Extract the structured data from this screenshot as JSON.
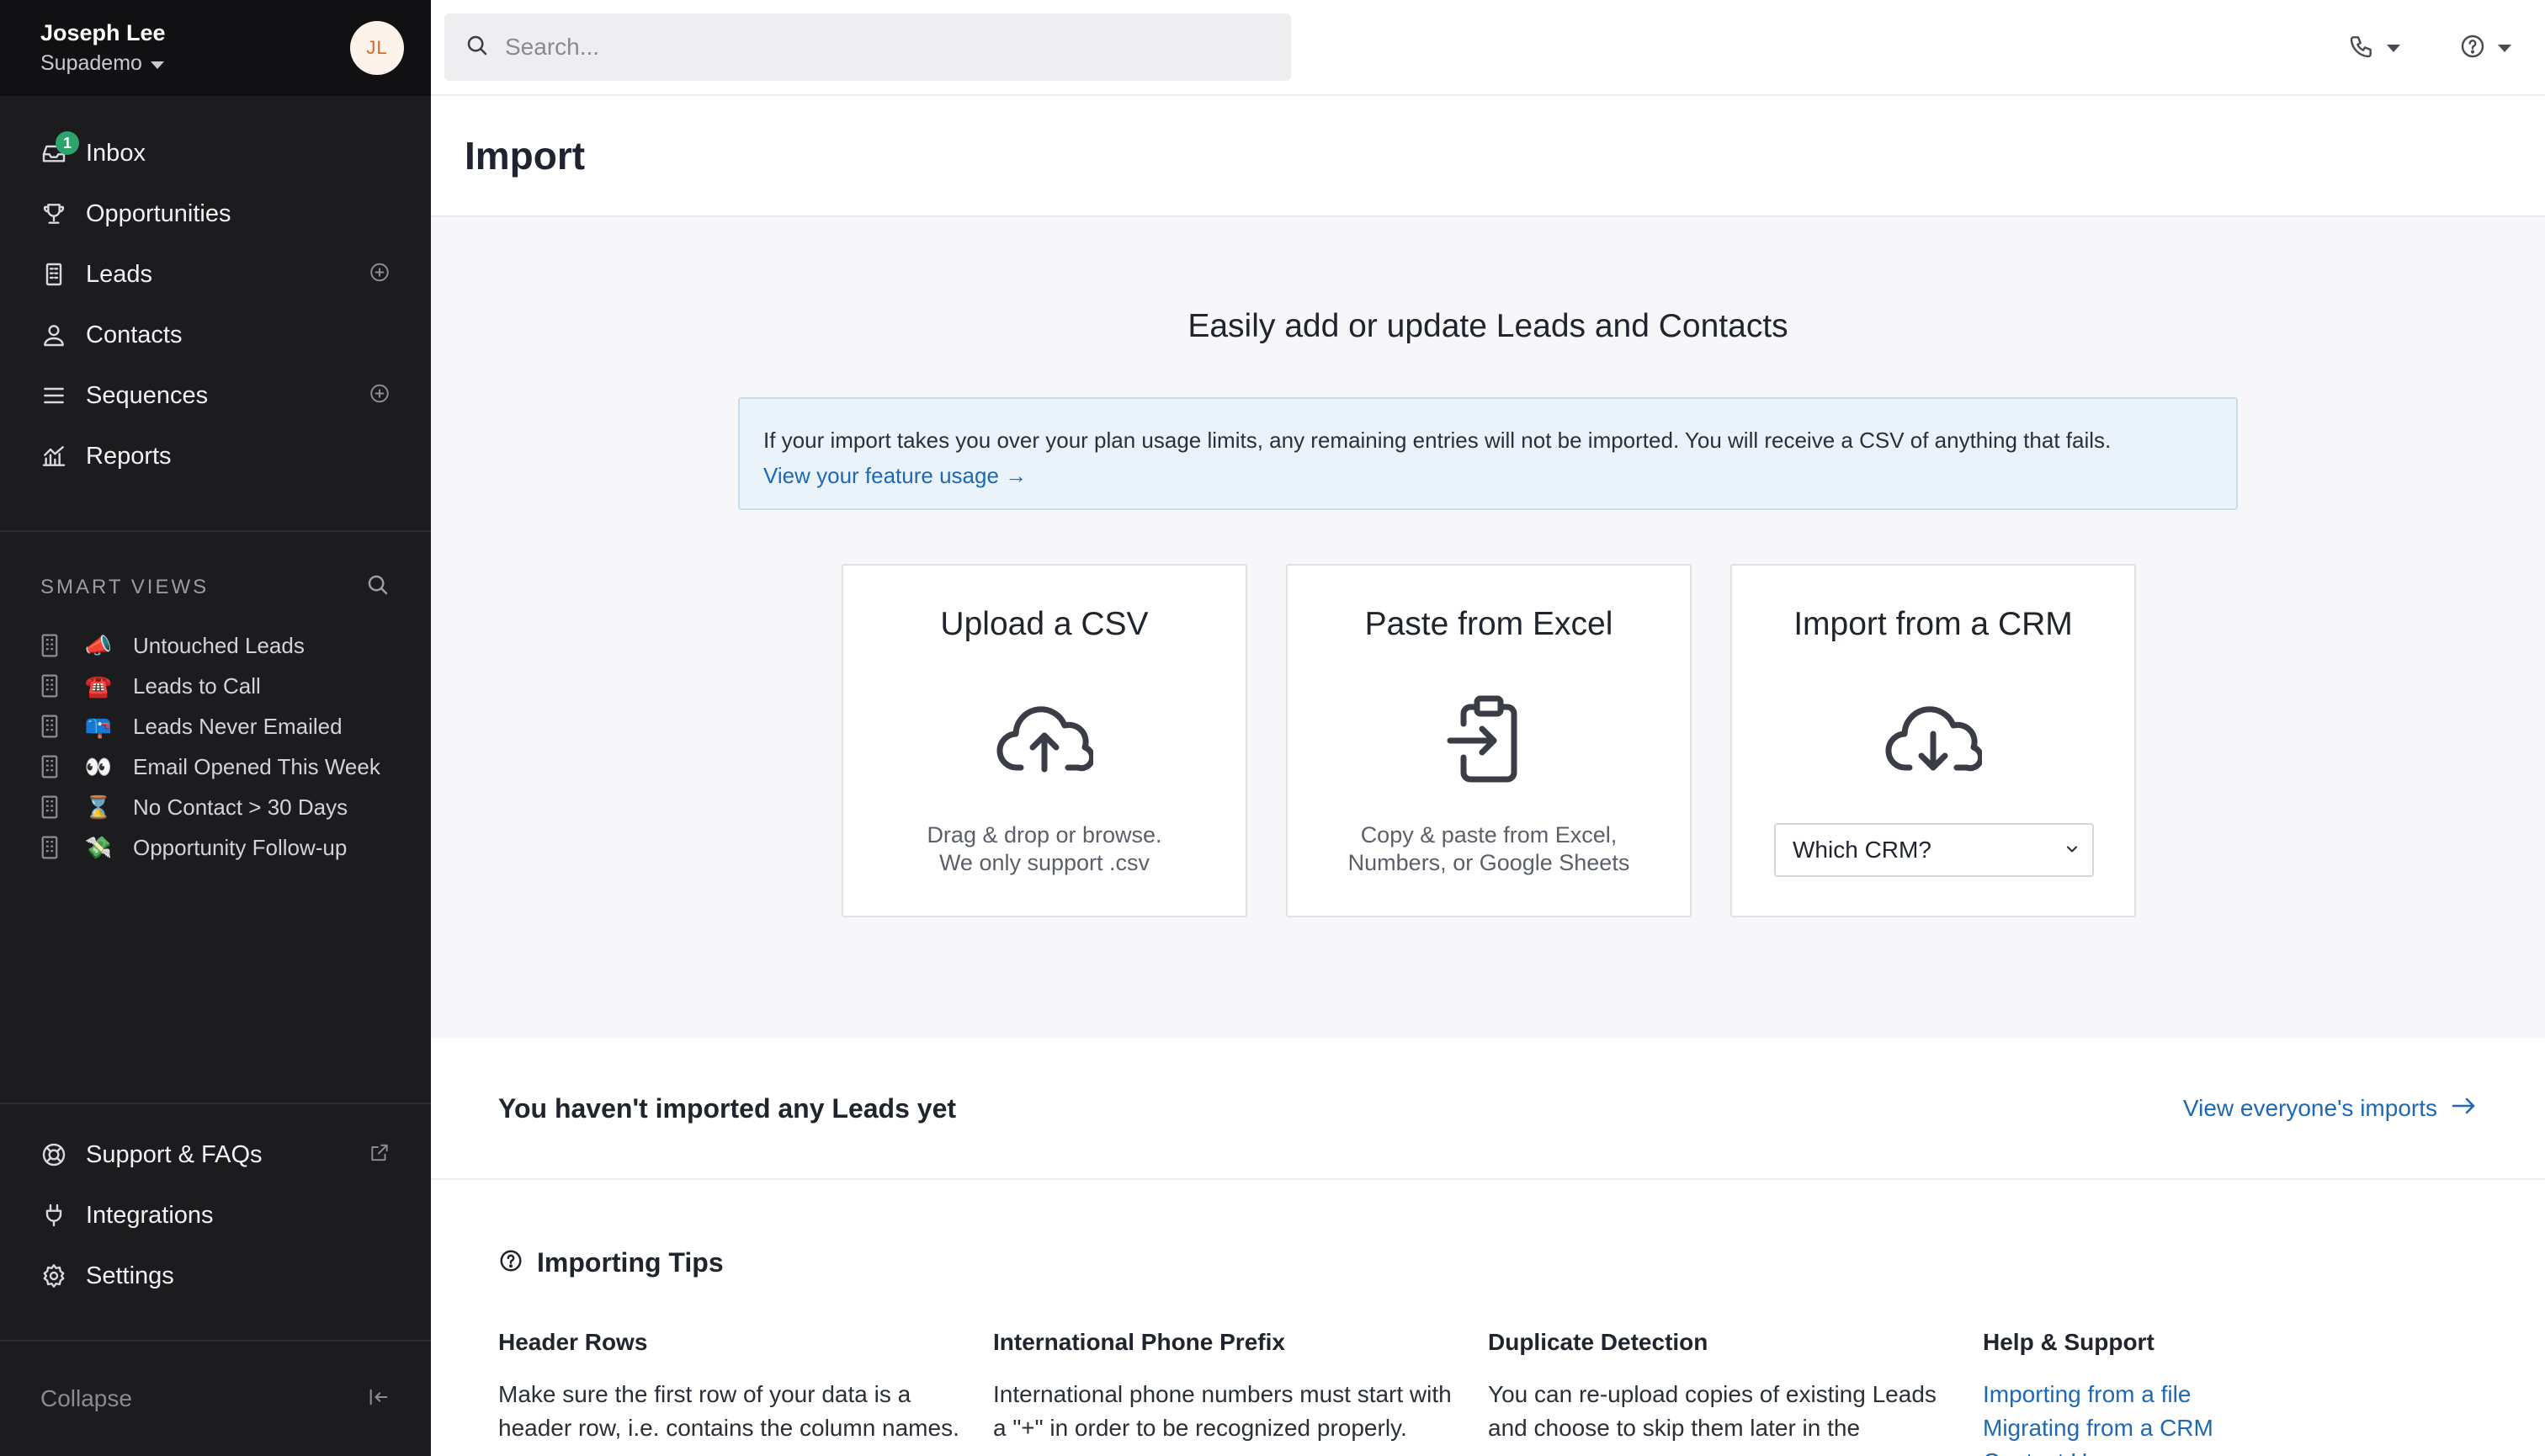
{
  "user": {
    "name": "Joseph Lee",
    "org": "Supademo",
    "initials": "JL"
  },
  "nav": {
    "inbox": {
      "label": "Inbox",
      "badge": "1"
    },
    "opportunities": {
      "label": "Opportunities"
    },
    "leads": {
      "label": "Leads"
    },
    "contacts": {
      "label": "Contacts"
    },
    "sequences": {
      "label": "Sequences"
    },
    "reports": {
      "label": "Reports"
    }
  },
  "smart_views": {
    "title": "SMART VIEWS",
    "items": [
      {
        "emoji": "📣",
        "label": "Untouched Leads"
      },
      {
        "emoji": "☎️",
        "label": "Leads to Call"
      },
      {
        "emoji": "📪",
        "label": "Leads Never Emailed"
      },
      {
        "emoji": "👀",
        "label": "Email Opened This Week"
      },
      {
        "emoji": "⌛",
        "label": "No Contact > 30 Days"
      },
      {
        "emoji": "💸",
        "label": "Opportunity Follow-up"
      }
    ]
  },
  "bottom_nav": {
    "support": "Support & FAQs",
    "integrations": "Integrations",
    "settings": "Settings",
    "collapse": "Collapse"
  },
  "search": {
    "placeholder": "Search..."
  },
  "page": {
    "title": "Import"
  },
  "import": {
    "headline": "Easily add or update Leads and Contacts",
    "notice_text": "If your import takes you over your plan usage limits, any remaining entries will not be imported. You will receive a CSV of anything that fails.",
    "notice_link": "View your feature usage →",
    "cards": {
      "csv": {
        "title": "Upload a CSV",
        "desc_line1": "Drag & drop or browse.",
        "desc_line2": "We only support .csv"
      },
      "excel": {
        "title": "Paste from Excel",
        "desc_line1": "Copy & paste from Excel,",
        "desc_line2": "Numbers, or Google Sheets"
      },
      "crm": {
        "title": "Import from a CRM",
        "select_value": "Which CRM?"
      }
    }
  },
  "imports": {
    "empty": "You haven't imported any Leads yet",
    "view_all": "View everyone's imports"
  },
  "tips": {
    "title": "Importing Tips",
    "header_rows": {
      "title": "Header Rows",
      "body": "Make sure the first row of your data is a header row, i.e. contains the column names."
    },
    "intl_phone": {
      "title": "International Phone Prefix",
      "body": "International phone numbers must start with a \"+\" in order to be recognized properly."
    },
    "duplicates": {
      "title": "Duplicate Detection",
      "body": "You can re-upload copies of existing Leads and choose to skip them later in the process."
    },
    "help": {
      "title": "Help & Support",
      "link1": "Importing from a file",
      "link2": "Migrating from a CRM",
      "link3": "Contact Us"
    }
  },
  "colors": {
    "sidebar_bg": "#1c1c1f",
    "link": "#1f68b3",
    "badge": "#2ea36b",
    "notice_bg": "#eaf3fa"
  }
}
